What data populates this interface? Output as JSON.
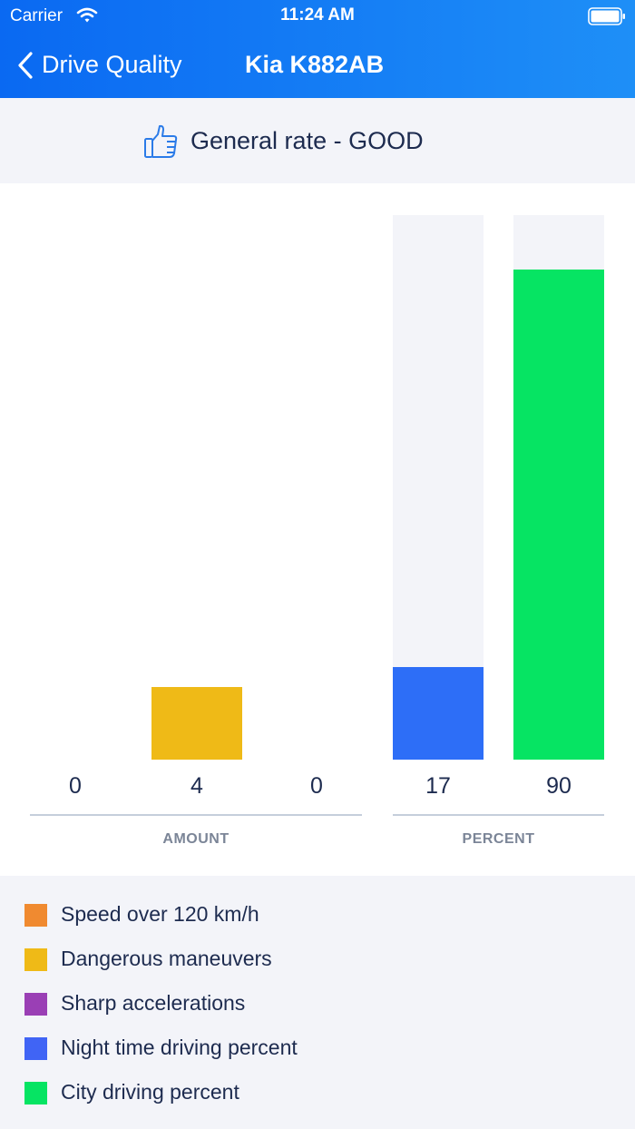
{
  "status_bar": {
    "carrier": "Carrier",
    "time": "11:24 AM"
  },
  "nav": {
    "back_label": "Drive Quality",
    "title": "Kia K882AB"
  },
  "rating": {
    "text": "General rate - GOOD",
    "icon": "thumbs-up-icon"
  },
  "chart_data": {
    "type": "bar",
    "groups": [
      {
        "axis_label": "AMOUNT",
        "ymax": 30,
        "bars": [
          {
            "legend": "Speed over 120 km/h",
            "value": 0,
            "label": "0",
            "color": "#f08a30"
          },
          {
            "legend": "Dangerous maneuvers",
            "value": 4,
            "label": "4",
            "color": "#efba17"
          },
          {
            "legend": "Sharp accelerations",
            "value": 0,
            "label": "0",
            "color": "#9a3fb5"
          }
        ]
      },
      {
        "axis_label": "PERCENT",
        "ymax": 100,
        "bars": [
          {
            "legend": "Night time driving percent",
            "value": 17,
            "label": "17",
            "color": "#2d6ef7"
          },
          {
            "legend": "City driving percent",
            "value": 90,
            "label": "90",
            "color": "#06e463"
          }
        ]
      }
    ]
  },
  "legend": [
    {
      "label": "Speed over 120 km/h",
      "color": "#f08a30"
    },
    {
      "label": "Dangerous maneuvers",
      "color": "#efba17"
    },
    {
      "label": "Sharp accelerations",
      "color": "#9a3fb5"
    },
    {
      "label": "Night time driving percent",
      "color": "#4064f5"
    },
    {
      "label": "City driving percent",
      "color": "#06e463"
    }
  ]
}
